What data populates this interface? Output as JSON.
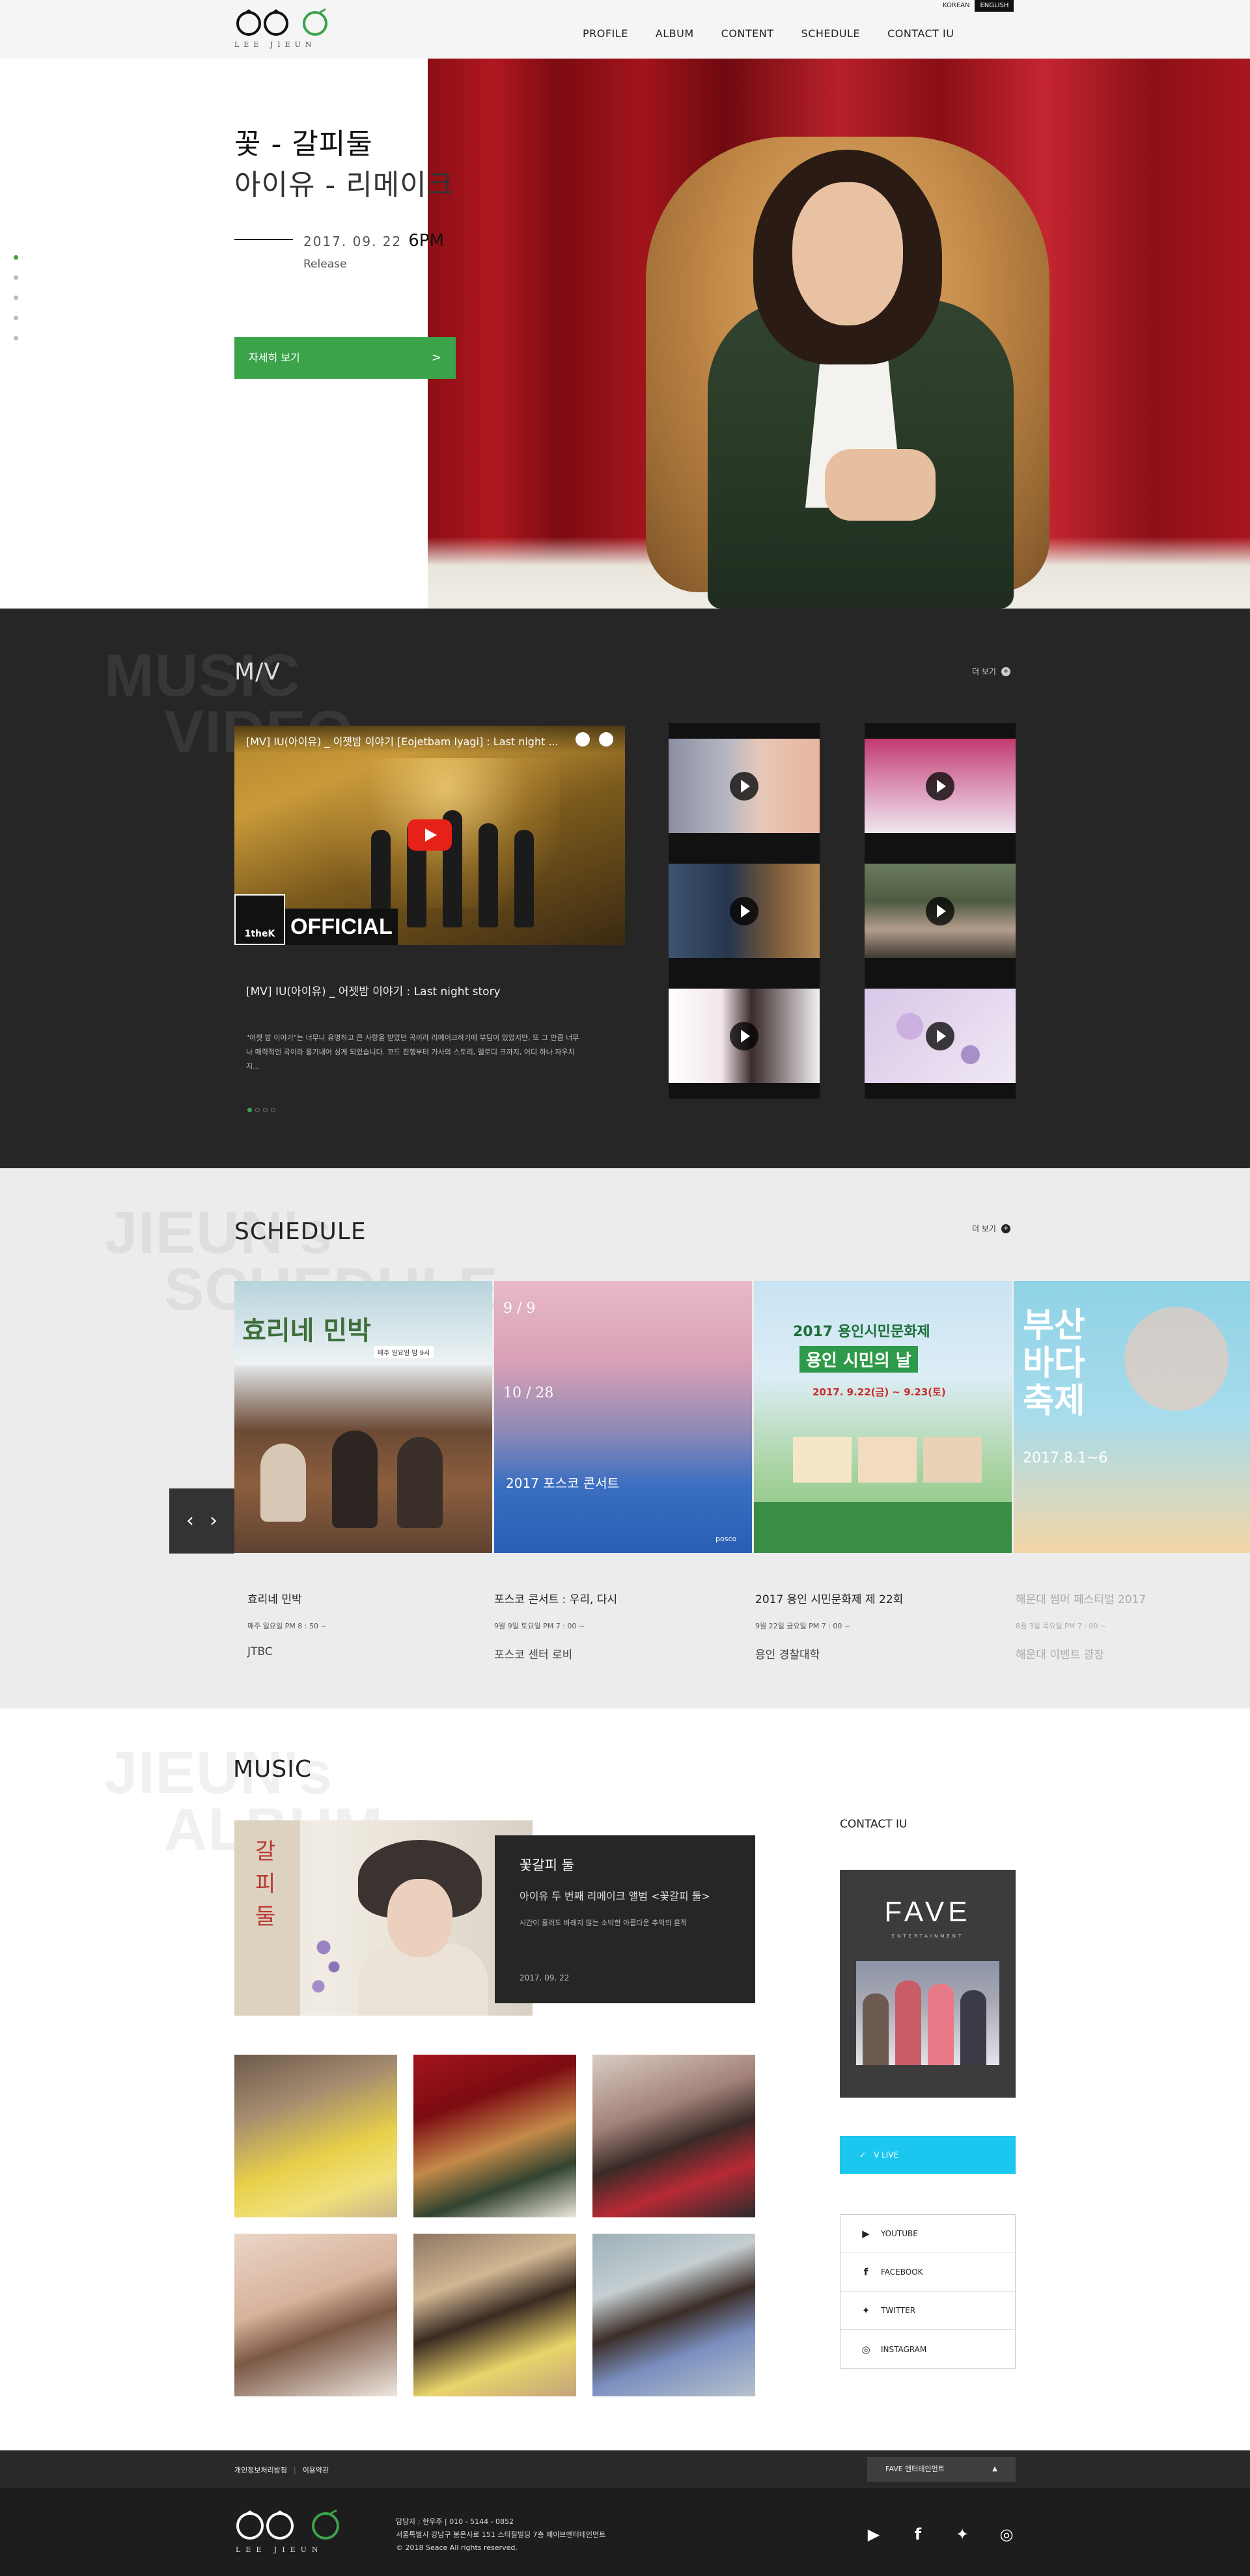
{
  "header": {
    "logo_text": "LEE  JIEUN",
    "nav": [
      "PROFILE",
      "ALBUM",
      "CONTENT",
      "SCHEDULE",
      "CONTACT IU"
    ],
    "lang": [
      "KOREAN",
      "ENGLISH"
    ]
  },
  "hero": {
    "title1": "꽃 - 갈피둘",
    "title2": "아이유 - 리메이크",
    "date": "2017. 09. 22",
    "time": "6PM",
    "release": "Release",
    "button": "자세히 보기",
    "button_arrow": ">",
    "slide_count": 5,
    "active_slide": 1
  },
  "mv": {
    "bg_label_1": "MUSIC",
    "bg_label_2": "VIDEO",
    "title": "M/V",
    "more": "더 보기",
    "player_title": "[MV] IU(아이유) _ 이젯밤 이야기 [Eojetbam Iyagi] : Last night ...",
    "official_badge": "1theK",
    "official_text": "OFFICIAL",
    "caption": "[MV] IU(아이유) _ 어젯밤 이야기 : Last night story",
    "desc": "\"어젯 밤 이야기\"는 너무나 유명하고 큰 사랑을 받았던 곡이라 리메이크하기에 부담이 있었지만, 또 그 만큼 너무나 매력적인 곡이라 흥기내어 싱게 되었습니다. 코드 진행부터 가사의 스토리, 멜로디 크까지, 어디 하나 자우치지...",
    "pager_count": 4,
    "accent": "#3ba34a"
  },
  "schedule": {
    "bg_label_1": "JIEUN's",
    "bg_label_2": "SCHEDULE",
    "title": "SCHEDULE",
    "more": "더 보기",
    "prev": "‹",
    "next": "›",
    "items": [
      {
        "name": "효리네 민박",
        "time": "매주 일요일 PM 8 : 50 ~",
        "place": "JTBC",
        "poster_title": "효리네 민박",
        "poster_sub": "매주 일요일 밤 9시"
      },
      {
        "name": "포스코 콘서트 : 우리, 다시",
        "time": "9월 9일 토요일 PM 7 : 00 ~",
        "place": "포스코 센터 로비",
        "poster_d1": "9 / 9",
        "poster_d2": "10 / 28",
        "poster_title": "2017 포스코 콘서트",
        "poster_brand": "posco"
      },
      {
        "name": "2017 용인 시민문화제 제 22회",
        "time": "9월 22일 금요일 PM 7 : 00 ~",
        "place": "용인 경찰대학",
        "poster_head": "2017 용인시민문화제",
        "poster_title": "용인 시민의 날",
        "poster_date": "2017. 9.22(금) ~ 9.23(토)"
      },
      {
        "name": "해운대 썸머 페스티벌 2017",
        "time": "8월 3일 목요일 PM 7 : 00 ~",
        "place": "해운대 이벤트 광장",
        "poster_title": "부산 바다 축제",
        "poster_date": "2017.8.1~6"
      }
    ]
  },
  "music": {
    "bg_label_1": "JIEUN's",
    "bg_label_2": "ALBUM",
    "title": "MUSIC",
    "album_cover_glyphs": [
      "갈",
      "피",
      "둘"
    ],
    "album_name": "꽃갈피 둘",
    "album_sub": "아이유 두 번째 리메이크 앨범 <꽃갈피 둘>",
    "album_desc": "시간이 흘러도 바래지 않는 소박한 아름다운 추억의 흔적",
    "album_date": "2017. 09. 22"
  },
  "contact": {
    "title": "CONTACT IU",
    "fave_logo": "FAVE",
    "fave_sub": "ENTERTAINMENT",
    "vlive": "V LIVE",
    "social": [
      {
        "icon": "youtube-icon",
        "glyph": "▶",
        "label": "YOUTUBE"
      },
      {
        "icon": "facebook-icon",
        "glyph": "f",
        "label": "FACEBOOK"
      },
      {
        "icon": "twitter-icon",
        "glyph": "✦",
        "label": "TWITTER"
      },
      {
        "icon": "instagram-icon",
        "glyph": "◎",
        "label": "INSTAGRAM"
      }
    ]
  },
  "footer": {
    "privacy": "개인정보처리방침",
    "sep": "|",
    "terms": "이용약관",
    "family_select": "FAVE 엔터테인먼트",
    "caret": "▲",
    "logo_text": "LEE  JIEUN",
    "info_line1": "담당자 : 한우주  |  010 - 5144 - 0852",
    "info_line2": "서울특별시 강남구 봉은사로 151 스타필빌딩 7층 페이브엔터테인먼트",
    "info_line3": "© 2018 Seace All rights reserved.",
    "social": [
      "▶",
      "f",
      "✦",
      "◎"
    ]
  }
}
